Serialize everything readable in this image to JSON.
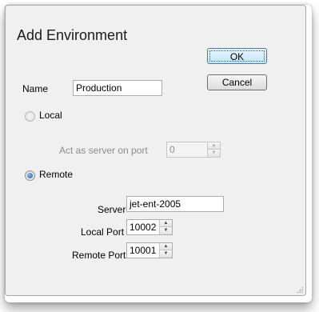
{
  "dialog": {
    "title": "Add Environment",
    "ok_label": "OK",
    "cancel_label": "Cancel",
    "name_label": "Name",
    "name_value": "Production",
    "local_option_label": "Local",
    "local_port_option_label": "Act as server on port",
    "local_port_value": "0",
    "remote_option_label": "Remote",
    "server_label": "Server",
    "server_value": "jet-ent-2005",
    "local_port_label": "Local Port",
    "local_port_spin_value": "10002",
    "remote_port_label": "Remote Port",
    "remote_port_spin_value": "10001",
    "selected_option": "Remote"
  },
  "icons": {
    "spin_up": "chevron-up-icon",
    "spin_down": "chevron-down-icon",
    "resize_grip": "resize-grip-icon"
  },
  "colors": {
    "dialog_bg": "#f0f0f0",
    "default_button_border": "#3c7fb1",
    "radio_selected": "#1d5ea8",
    "disabled_text": "#8d8d8d"
  }
}
